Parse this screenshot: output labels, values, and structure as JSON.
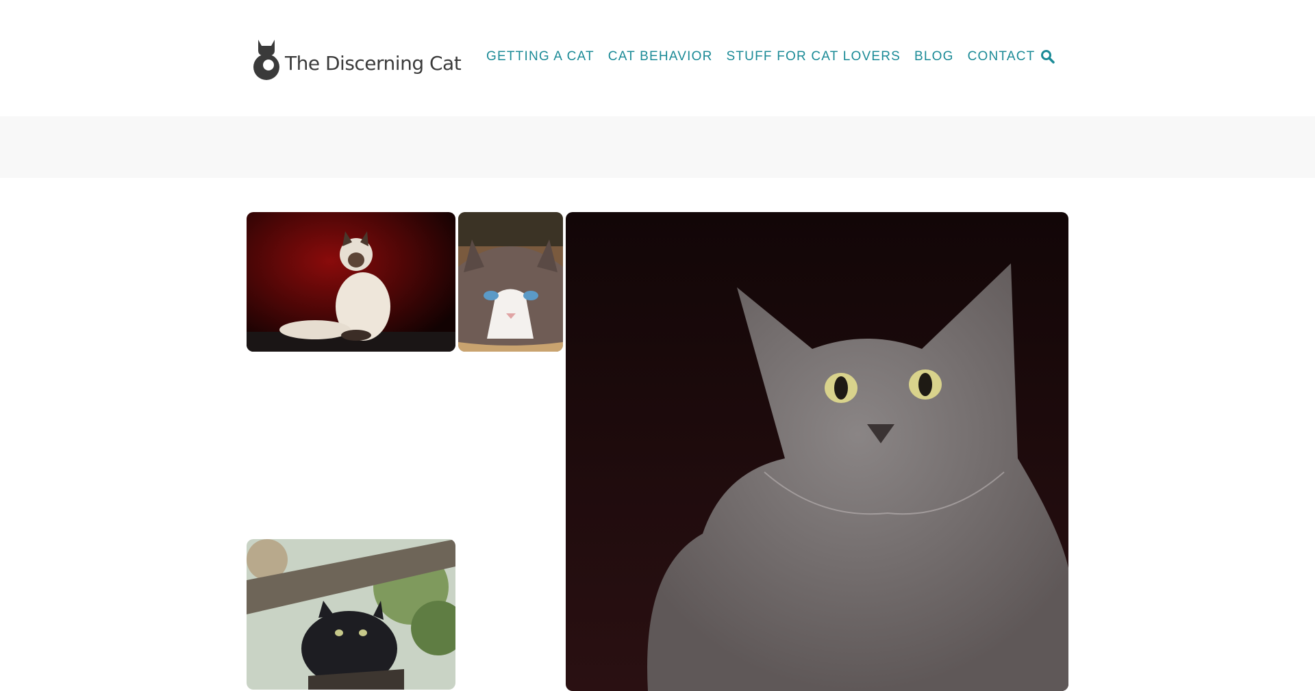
{
  "site": {
    "logo_text": "The Discerning Cat",
    "logo_icon": "cat-silhouette-icon"
  },
  "nav": {
    "items": [
      {
        "label": "GETTING A CAT"
      },
      {
        "label": "CAT BEHAVIOR"
      },
      {
        "label": "STUFF FOR CAT LOVERS"
      },
      {
        "label": "BLOG"
      },
      {
        "label": "CONTACT"
      }
    ],
    "search_icon": "search-icon"
  },
  "gallery": {
    "photos": [
      {
        "subject": "himalayan-cat-on-red-background"
      },
      {
        "subject": "ragdoll-cat-lying-down"
      },
      {
        "subject": "grey-nebelung-cat-portrait"
      },
      {
        "subject": "black-longhair-cat-on-branch"
      }
    ]
  },
  "colors": {
    "nav_link": "#1a8a96",
    "logo": "#3a3a3a",
    "band": "#f8f8f8"
  }
}
